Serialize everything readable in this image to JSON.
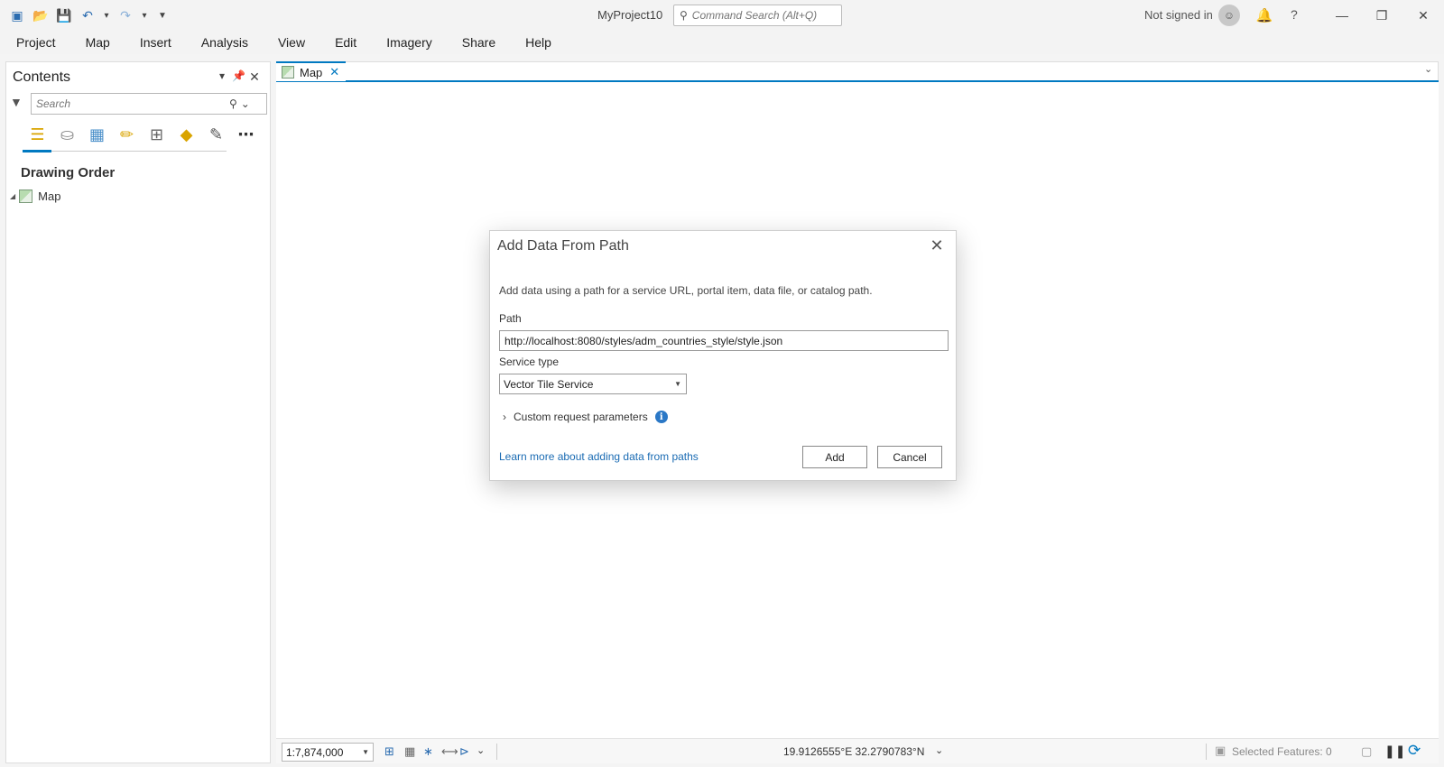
{
  "window": {
    "title": "MyProject10",
    "command_search_placeholder": "Command Search (Alt+Q)",
    "signin_status": "Not signed in",
    "help_label": "?"
  },
  "menu": {
    "tabs": [
      "Project",
      "Map",
      "Insert",
      "Analysis",
      "View",
      "Edit",
      "Imagery",
      "Share",
      "Help"
    ]
  },
  "contents": {
    "title": "Contents",
    "search_placeholder": "Search",
    "section_title": "Drawing Order",
    "tree": [
      {
        "label": "Map"
      }
    ]
  },
  "map_view": {
    "tab_label": "Map"
  },
  "status_bar": {
    "scale": "1:7,874,000",
    "coordinates": "19.9126555°E 32.2790783°N",
    "selected_features": "Selected Features: 0"
  },
  "dialog": {
    "title": "Add Data From Path",
    "description": "Add data using a path for a service URL, portal item, data file, or catalog path.",
    "path_label": "Path",
    "path_value": "http://localhost:8080/styles/adm_countries_style/style.json",
    "service_type_label": "Service type",
    "service_type_value": "Vector Tile Service",
    "custom_params_label": "Custom request parameters",
    "learn_more_link": "Learn more about adding data from paths",
    "add_button": "Add",
    "cancel_button": "Cancel"
  },
  "colors": {
    "accent": "#0079c1",
    "link": "#1a6bb3",
    "info": "#2b78c6"
  }
}
